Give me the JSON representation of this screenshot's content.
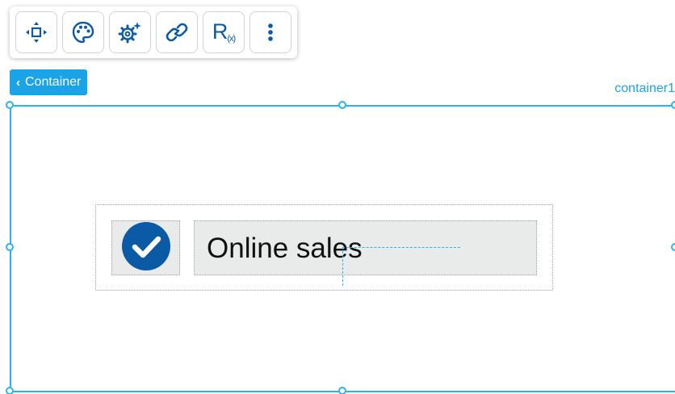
{
  "toolbar": {
    "buttons": [
      {
        "name": "move",
        "icon": "move-arrows-icon"
      },
      {
        "name": "style",
        "icon": "palette-icon"
      },
      {
        "name": "settings",
        "icon": "gear-sparkle-icon"
      },
      {
        "name": "link",
        "icon": "link-icon"
      },
      {
        "name": "formula",
        "icon": "formula-icon",
        "label_main": "R",
        "label_sub": "(x)"
      },
      {
        "name": "more",
        "icon": "more-vertical-icon"
      }
    ]
  },
  "breadcrumb": {
    "label": "Container",
    "icon": "chevron-left-icon"
  },
  "selection": {
    "name": "container1"
  },
  "content": {
    "check_icon": "check-circle-icon",
    "label": "Online sales"
  },
  "colors": {
    "accent": "#1aa3e6",
    "frame": "#2ab4ee",
    "icon_blue": "#0b5aa6",
    "cell_bg": "#e9ebea"
  }
}
